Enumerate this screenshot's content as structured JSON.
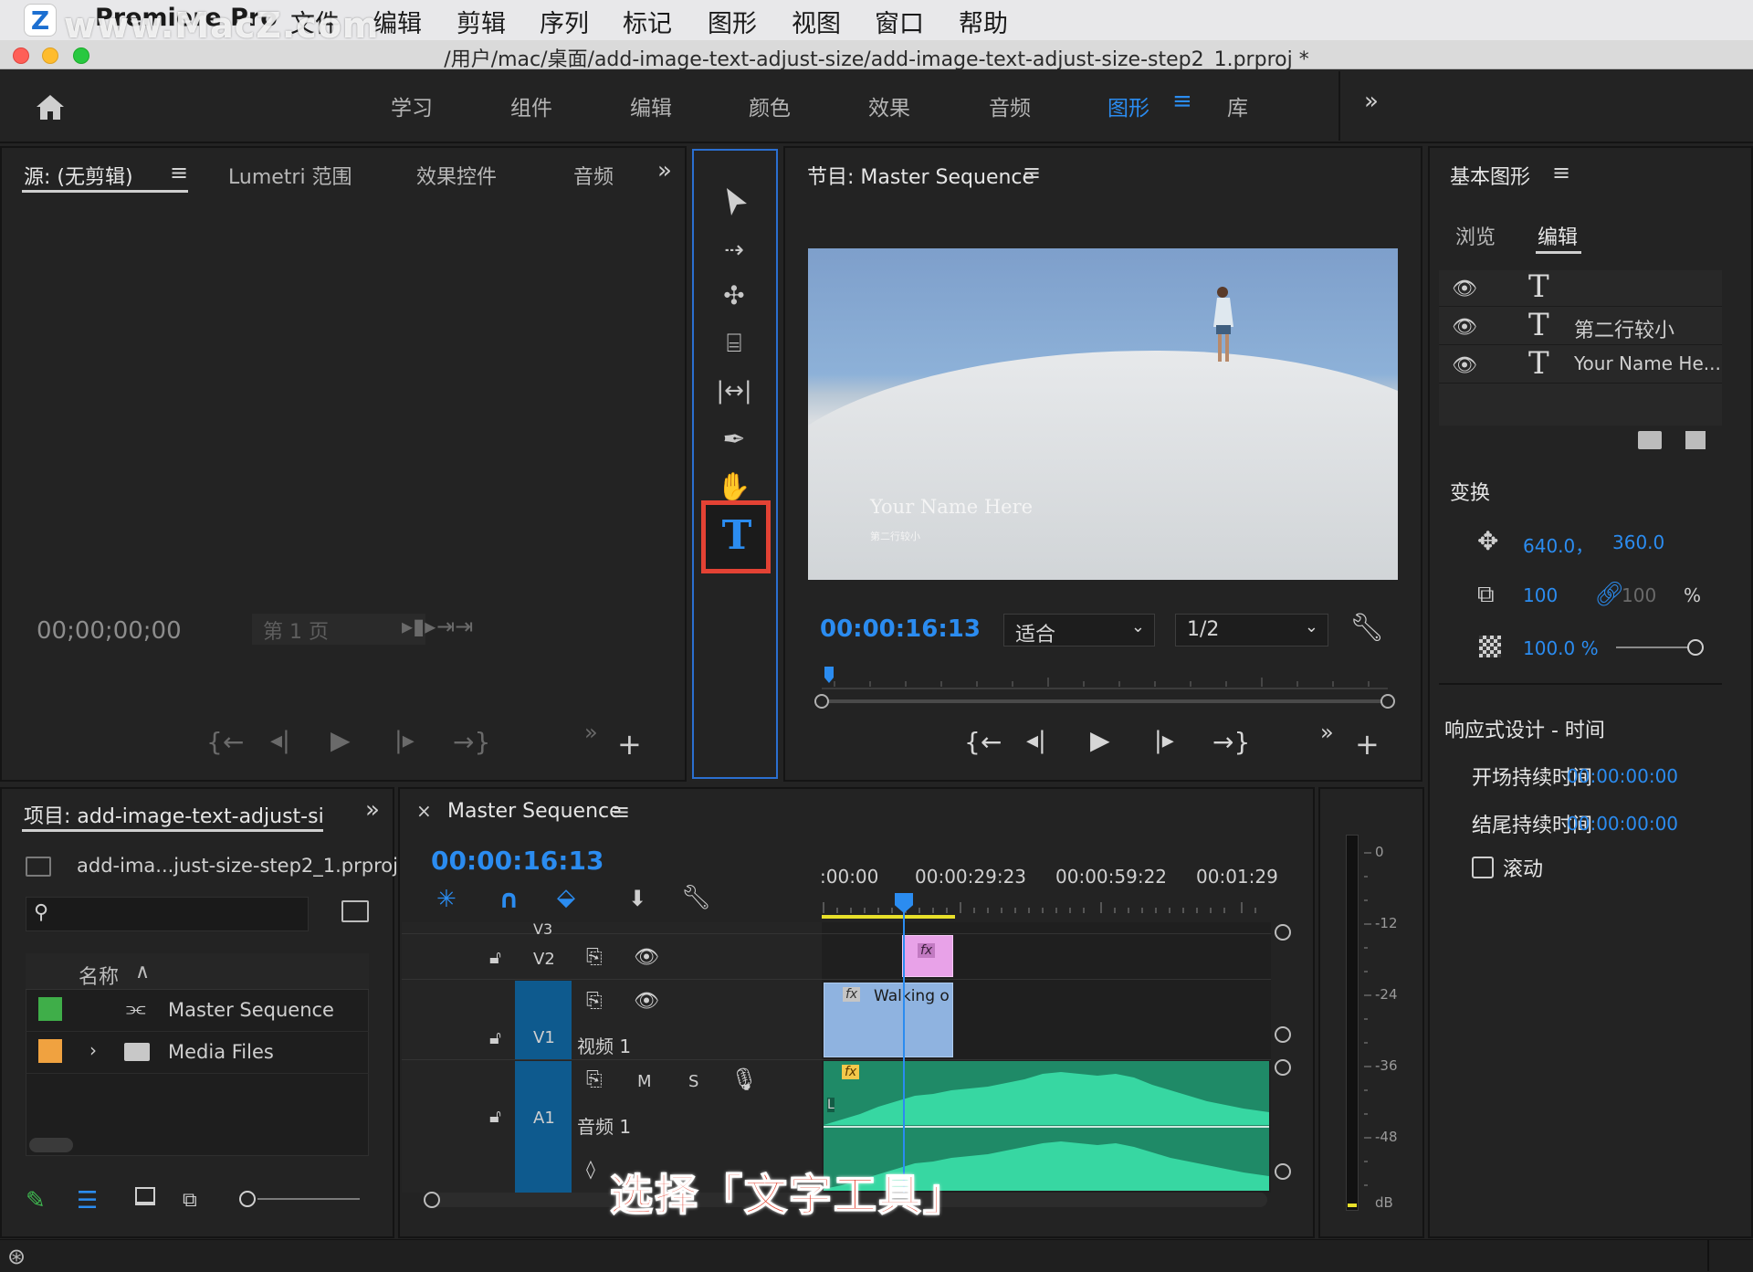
{
  "menubar": {
    "app_name": "Premiere Pro",
    "watermark": "www.MacZ.com",
    "items": [
      "文件",
      "编辑",
      "剪辑",
      "序列",
      "标记",
      "图形",
      "视图",
      "窗口",
      "帮助"
    ]
  },
  "window": {
    "title": "/用户/mac/桌面/add-image-text-adjust-size/add-image-text-adjust-size-step2_1.prproj *"
  },
  "workspaces": {
    "items": [
      "学习",
      "组件",
      "编辑",
      "颜色",
      "效果",
      "音频",
      "图形",
      "库"
    ],
    "active": "图形"
  },
  "source_panel": {
    "tabs": [
      "源: (无剪辑)",
      "Lumetri 范围",
      "效果控件",
      "音频"
    ],
    "timecode": "00;00;00;00",
    "page_label": "第 1 页"
  },
  "program_panel": {
    "title": "节目: Master Sequence",
    "overlay_title": "Your Name Here",
    "overlay_subtitle": "第二行较小",
    "timecode": "00:00:16:13",
    "fit": "适合",
    "resolution": "1/2"
  },
  "essential_graphics": {
    "title": "基本图形",
    "tabs": [
      "浏览",
      "编辑"
    ],
    "layers": [
      "",
      "第二行较小",
      "Your Name He..."
    ],
    "transform_label": "变换",
    "position_x": "640.0，",
    "position_y": "360.0",
    "scale": "100",
    "scale_linked": "100",
    "percent": "%",
    "opacity": "100.0 %",
    "responsive_label": "响应式设计 - 时间",
    "intro_label": "开场持续时间",
    "intro_value": "00:00:00:00",
    "outro_label": "结尾持续时间",
    "outro_value": "00:00:00:00",
    "roll_label": "滚动"
  },
  "project_panel": {
    "title": "项目: add-image-text-adjust-size-s",
    "file": "add-ima...just-size-step2_1.prproj",
    "column_name": "名称",
    "items": [
      {
        "name": "Master Sequence",
        "color": "#3fae49"
      },
      {
        "name": "Media Files",
        "color": "#f0a240"
      }
    ]
  },
  "timeline": {
    "title": "Master Sequence",
    "timecode": "00:00:16:13",
    "ruler": [
      ":00:00",
      "00:00:29:23",
      "00:00:59:22",
      "00:01:29"
    ],
    "tracks": {
      "v3": "V3",
      "v2": "V2",
      "v1": "V1",
      "v1_name": "视频 1",
      "a1": "A1",
      "a1_name": "音频 1",
      "m": "M",
      "s": "S"
    },
    "clip_v1": "Walking o",
    "fx": "fx",
    "audio_L": "L"
  },
  "meter": {
    "labels": [
      "0",
      "-12",
      "-24",
      "-36",
      "-48",
      "dB"
    ]
  },
  "subtitle": "选择「文字工具」"
}
